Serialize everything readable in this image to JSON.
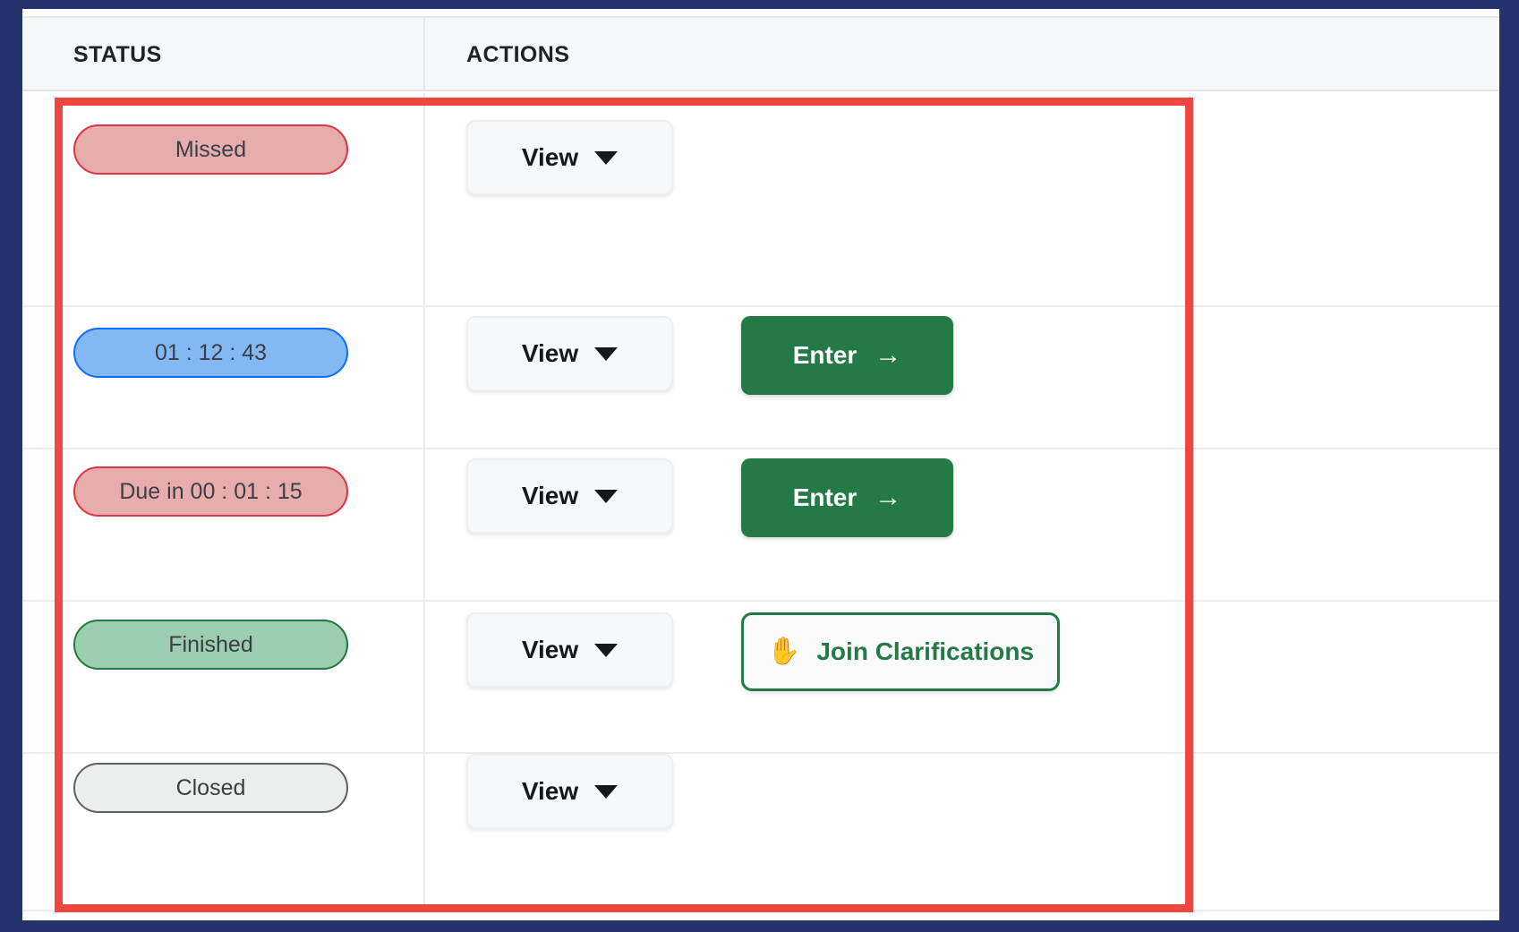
{
  "frame": {
    "border_color": "#24336b",
    "annotation_color": "#ee4640"
  },
  "table": {
    "columns": [
      {
        "key": "status",
        "label": "STATUS"
      },
      {
        "key": "actions",
        "label": "ACTIONS"
      }
    ],
    "rows": [
      {
        "status": {
          "label": "Missed",
          "variant": "danger"
        },
        "actions": [
          {
            "type": "view",
            "label": "View",
            "icon": "chevron-down-icon"
          }
        ]
      },
      {
        "status": {
          "label": "01 : 12 : 43",
          "variant": "info"
        },
        "actions": [
          {
            "type": "view",
            "label": "View",
            "icon": "chevron-down-icon"
          },
          {
            "type": "enter",
            "label": "Enter",
            "icon": "arrow-right-icon"
          }
        ]
      },
      {
        "status": {
          "label": "Due in 00 : 01 : 15",
          "variant": "danger"
        },
        "actions": [
          {
            "type": "view",
            "label": "View",
            "icon": "chevron-down-icon"
          },
          {
            "type": "enter",
            "label": "Enter",
            "icon": "arrow-right-icon"
          }
        ]
      },
      {
        "status": {
          "label": "Finished",
          "variant": "success"
        },
        "actions": [
          {
            "type": "view",
            "label": "View",
            "icon": "chevron-down-icon"
          },
          {
            "type": "join",
            "label": "Join Clarifications",
            "icon": "raised-hand-icon"
          }
        ]
      },
      {
        "status": {
          "label": "Closed",
          "variant": "default"
        },
        "actions": [
          {
            "type": "view",
            "label": "View",
            "icon": "chevron-down-icon"
          }
        ]
      }
    ]
  },
  "icons": {
    "chevron_down": "▼",
    "arrow_right": "→",
    "raised_hand": "✋"
  },
  "colors": {
    "badge_danger_bg": "#e7adad",
    "badge_danger_border": "#dc3545",
    "badge_info_bg": "#84b8f5",
    "badge_info_border": "#0d6efd",
    "badge_success_bg": "#9ccdaf",
    "badge_success_border": "#1f7a45",
    "badge_default_bg": "#eceded",
    "badge_default_border": "#5d6166",
    "brand_green": "#237a47",
    "header_bg": "#f6f7f9"
  }
}
